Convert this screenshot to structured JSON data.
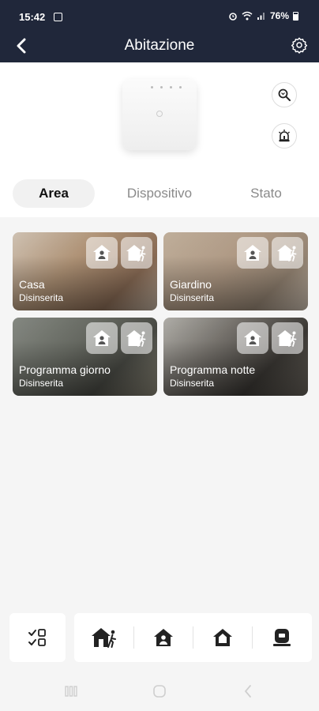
{
  "status_bar": {
    "time": "15:42",
    "battery": "76%"
  },
  "header": {
    "title": "Abitazione"
  },
  "tabs": [
    {
      "label": "Area",
      "active": true
    },
    {
      "label": "Dispositivo",
      "active": false
    },
    {
      "label": "Stato",
      "active": false
    }
  ],
  "areas": [
    {
      "name": "Casa",
      "state": "Disinserita"
    },
    {
      "name": "Giardino",
      "state": "Disinserita"
    },
    {
      "name": "Programma giorno",
      "state": "Disinserita"
    },
    {
      "name": "Programma notte",
      "state": "Disinserita"
    }
  ],
  "icons": {
    "back": "back-arrow-icon",
    "settings": "gear-icon",
    "search_device": "search-icon",
    "siren": "siren-icon",
    "home_arm": "home-person-icon",
    "home_away": "home-walk-icon",
    "checklist": "checklist-icon",
    "disarm": "home-outline-icon",
    "panic": "sos-icon"
  },
  "colors": {
    "header_bg": "#20273a",
    "accent": "#20273a"
  }
}
